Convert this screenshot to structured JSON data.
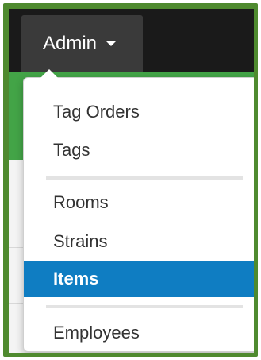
{
  "navbar": {
    "admin_label": "Admin"
  },
  "admin_menu": {
    "groups": [
      {
        "items": [
          "Tag Orders",
          "Tags"
        ]
      },
      {
        "items": [
          "Rooms",
          "Strains",
          "Items"
        ]
      },
      {
        "items": [
          "Employees"
        ]
      }
    ],
    "active_item": "Items",
    "active_color": "#0f7dc2"
  },
  "colors": {
    "frame": "#4f8a2f",
    "navbar": "#1a1a1a",
    "admin_button": "#3a3a3a",
    "header_band": "#43a447"
  }
}
